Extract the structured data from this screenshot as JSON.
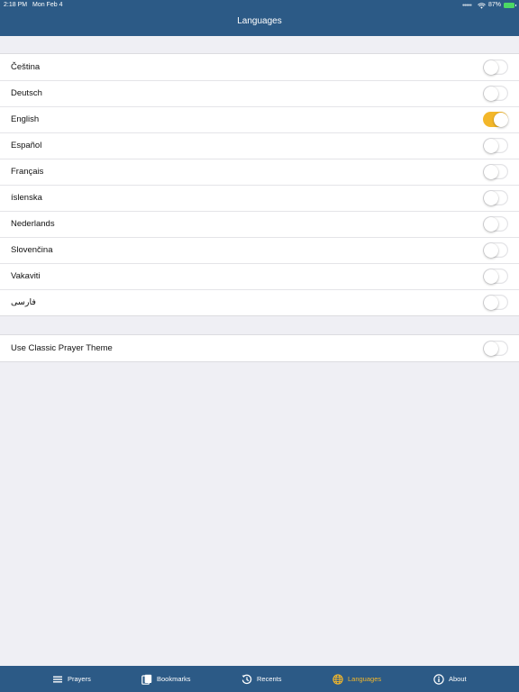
{
  "status_bar": {
    "time": "2:18 PM",
    "date": "Mon Feb 4",
    "battery": "87%"
  },
  "header": {
    "title": "Languages"
  },
  "languages": [
    {
      "label": "Čeština",
      "on": false
    },
    {
      "label": "Deutsch",
      "on": false
    },
    {
      "label": "English",
      "on": true
    },
    {
      "label": "Español",
      "on": false
    },
    {
      "label": "Français",
      "on": false
    },
    {
      "label": "íslenska",
      "on": false
    },
    {
      "label": "Nederlands",
      "on": false
    },
    {
      "label": "Slovenčina",
      "on": false
    },
    {
      "label": "Vakaviti",
      "on": false
    },
    {
      "label": "فارسی",
      "on": false
    }
  ],
  "settings": [
    {
      "label": "Use Classic Prayer Theme",
      "on": false
    }
  ],
  "tabs": [
    {
      "label": "Prayers",
      "icon": "list-icon",
      "active": false
    },
    {
      "label": "Bookmarks",
      "icon": "bookmarks-icon",
      "active": false
    },
    {
      "label": "Recents",
      "icon": "history-icon",
      "active": false
    },
    {
      "label": "Languages",
      "icon": "globe-icon",
      "active": true
    },
    {
      "label": "About",
      "icon": "info-icon",
      "active": false
    }
  ],
  "colors": {
    "nav": "#2c5a86",
    "accent": "#f3b72a",
    "background": "#efeff4"
  }
}
